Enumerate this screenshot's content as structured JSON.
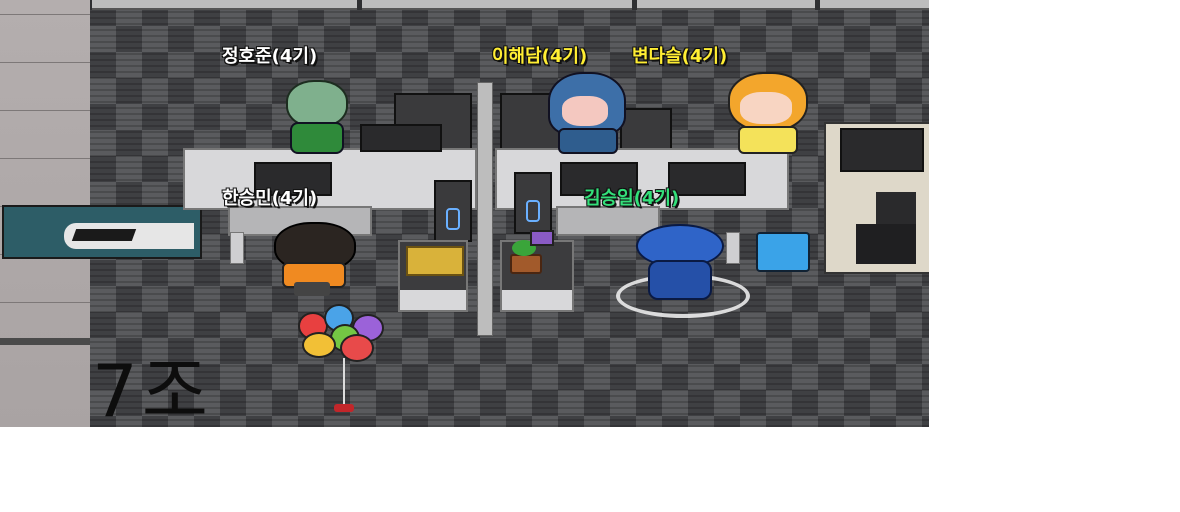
{
  "room": {
    "group_label": "7조"
  },
  "players": [
    {
      "name": "정호준(4기)",
      "color": "#ffffff"
    },
    {
      "name": "이해담(4기)",
      "color": "#ffee33"
    },
    {
      "name": "변다슬(4기)",
      "color": "#ffee33"
    },
    {
      "name": "한승민(4기)",
      "color": "#ffffff"
    },
    {
      "name": "김승일(4기)",
      "color": "#33e07a"
    }
  ]
}
